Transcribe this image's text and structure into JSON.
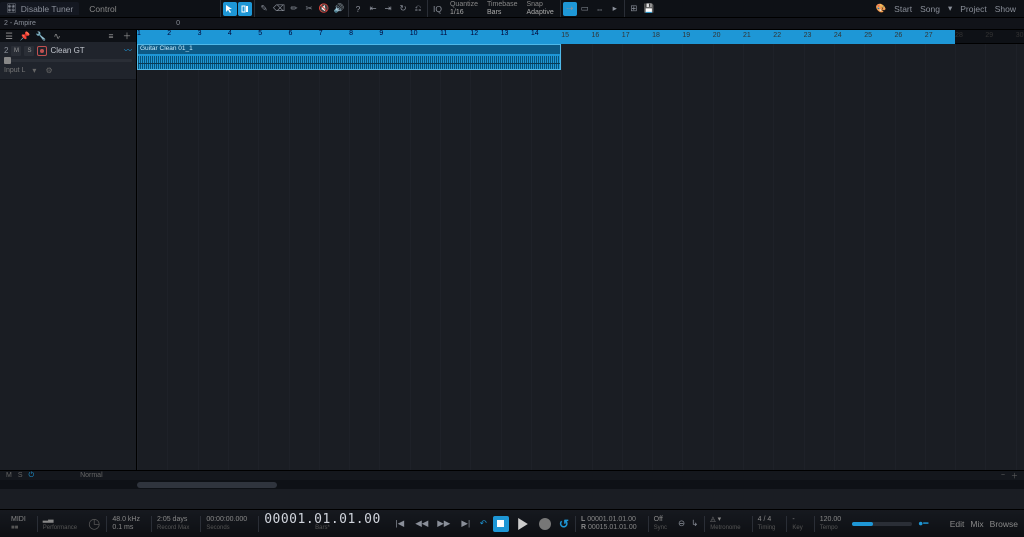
{
  "header": {
    "title": "Disable Tuner",
    "sub_device": "2 - Ampire",
    "sub_value": "0",
    "control_label": "Control",
    "quantize_label": "Quantize",
    "quantize_value": "1/16",
    "timebase_label": "Timebase",
    "timebase_value": "Bars",
    "snap_label": "Snap",
    "snap_value": "Adaptive",
    "iq_label": "IQ",
    "right_links": [
      "Start",
      "Song",
      "Project",
      "Show"
    ]
  },
  "track": {
    "index": "2",
    "m": "M",
    "s": "S",
    "name": "Clean GT",
    "input": "Input L",
    "clip_name": "Guitar Clean 01_1"
  },
  "ruler": {
    "bars": [
      1,
      2,
      3,
      4,
      5,
      6,
      7,
      8,
      9,
      10,
      11,
      12,
      13,
      14,
      15,
      16,
      17,
      18,
      19,
      20,
      21,
      22,
      23,
      24,
      25,
      26,
      27,
      28,
      29,
      30
    ]
  },
  "footer_ms": {
    "m": "M",
    "s": "S",
    "mode": "Normal"
  },
  "transport": {
    "midi_label": "MIDI",
    "perf_label": "Performance",
    "sr": "48.0 kHz",
    "latency": "0.1 ms",
    "recmax_lbl": "Record Max",
    "recmax": "2:05 days",
    "seconds_lbl": "Seconds",
    "seconds": "00:00:00.000",
    "main": "00001.01.01.00",
    "main_lbl": "Bars*",
    "loop_l": "00001.01.01.00",
    "loop_r": "00015.01.01.00",
    "l_lbl": "L",
    "r_lbl": "R",
    "sync": "Off",
    "sync_lbl": "Sync",
    "metro_lbl": "Metronome",
    "timesig": "4 / 4",
    "timing_lbl": "Timing",
    "key": "-",
    "key_lbl": "Key",
    "tempo": "120.00",
    "tempo_lbl": "Tempo",
    "right": [
      "Edit",
      "Mix",
      "Browse"
    ]
  }
}
